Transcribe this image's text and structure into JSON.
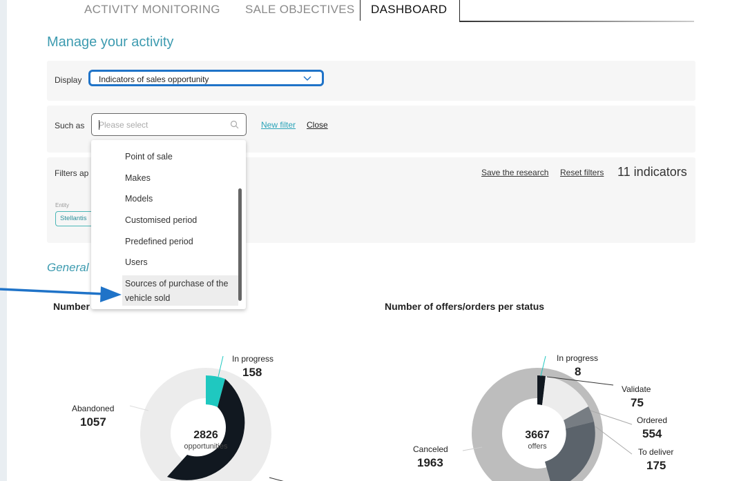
{
  "tabs": {
    "activity": "ACTIVITY MONITORING",
    "objectives": "SALE OBJECTIVES",
    "dashboard": "DASHBOARD"
  },
  "header": {
    "title": "Manage your activity"
  },
  "display": {
    "label": "Display",
    "value": "Indicators of sales opportunity"
  },
  "filter": {
    "label": "Such as",
    "placeholder": "Please select",
    "new_filter": "New filter",
    "close": "Close"
  },
  "dropdown": {
    "items": [
      "Point of sale",
      "Makes",
      "Models",
      "Customised period",
      "Predefined period",
      "Users",
      "Sources of purchase of the",
      "vehicle sold"
    ]
  },
  "filters_applied": {
    "label": "Filters ap",
    "save": "Save the research",
    "reset": "Reset filters",
    "count": "11 indicators",
    "entity_label": "Entity",
    "entity_value": "Stellantis"
  },
  "section": {
    "title": "General :"
  },
  "colors": {
    "accent": "#3d9bb0",
    "select_border": "#1f73c8",
    "arrow": "#1f73c8",
    "teal": "#1fc8c0",
    "dark": "#111820"
  },
  "chart_data": [
    {
      "type": "pie",
      "title": "Number",
      "center_value": "2826",
      "center_label": "opportunities",
      "slices": [
        {
          "name": "In progress",
          "value": 158
        },
        {
          "name": "Abandoned",
          "value": 1057
        }
      ]
    },
    {
      "type": "pie",
      "title": "Number of offers/orders per status",
      "center_value": "3667",
      "center_label": "offers",
      "slices": [
        {
          "name": "In progress",
          "value": 8
        },
        {
          "name": "Validate",
          "value": 75
        },
        {
          "name": "Ordered",
          "value": 554
        },
        {
          "name": "To deliver",
          "value": 175
        },
        {
          "name": "Canceled",
          "value": 1963
        }
      ]
    }
  ]
}
